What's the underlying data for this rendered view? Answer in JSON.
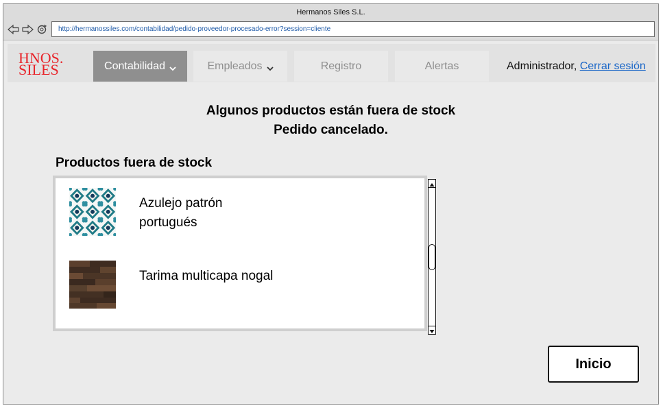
{
  "window": {
    "title": "Hermanos Siles S.L."
  },
  "browser": {
    "url": "http://hermanossiles.com/contabilidad/pedido-proveedor-procesado-error?session=cliente",
    "icons": [
      "back-arrow-icon",
      "forward-arrow-icon",
      "reload-icon"
    ]
  },
  "logo": {
    "line1": "HNOS.",
    "line2": "SILES",
    "color": "#e8242a"
  },
  "nav": {
    "items": [
      {
        "label": "Contabilidad",
        "active": true,
        "has_dropdown": true
      },
      {
        "label": "Empleados",
        "active": false,
        "has_dropdown": true
      },
      {
        "label": "Registro",
        "active": false,
        "has_dropdown": false
      },
      {
        "label": "Alertas",
        "active": false,
        "has_dropdown": false
      }
    ],
    "user": {
      "name": "Administrador,",
      "logout_label": "Cerrar sesión"
    }
  },
  "message": {
    "line1": "Algunos productos están fuera de stock",
    "line2": "Pedido cancelado."
  },
  "out_of_stock": {
    "title": "Productos fuera de stock",
    "items": [
      {
        "name": "Azulejo patrón portugués",
        "image": "tile-pattern-image"
      },
      {
        "name": "Tarima multicapa nogal",
        "image": "walnut-floor-image"
      }
    ]
  },
  "actions": {
    "home_label": "Inicio"
  },
  "colors": {
    "active_tab": "#8f8f8f",
    "link": "#1a66c7",
    "logo": "#e8242a"
  }
}
